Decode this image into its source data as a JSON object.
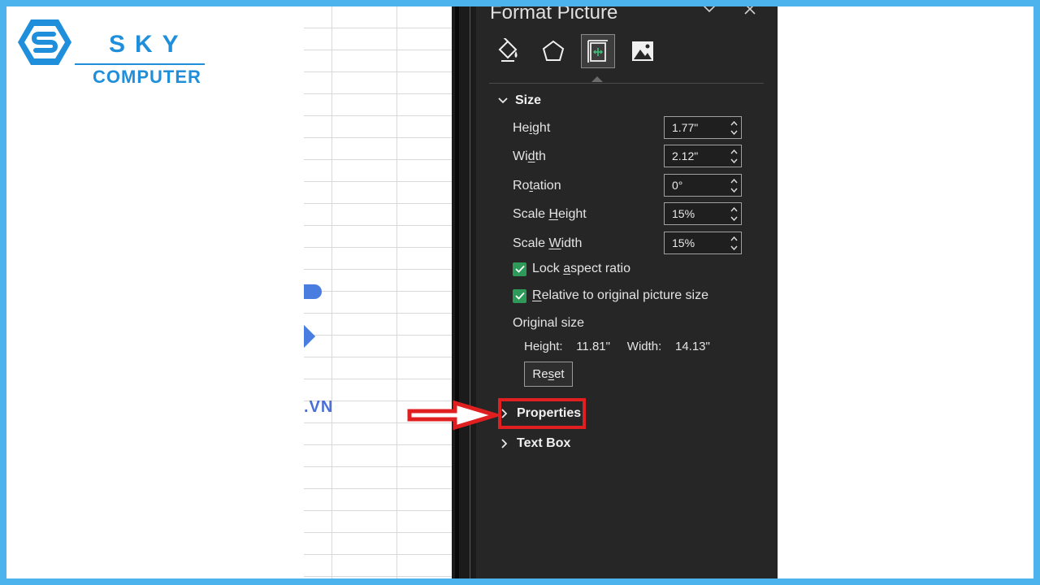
{
  "logo": {
    "brand": "SKY",
    "sub": "COMPUTER"
  },
  "sheet": {
    "fragment_text": ".VN"
  },
  "panel": {
    "title": "Format Picture",
    "tabs": [
      {
        "icon": "fill-line-icon",
        "active": false
      },
      {
        "icon": "effects-pentagon-icon",
        "active": false
      },
      {
        "icon": "size-properties-icon",
        "active": true
      },
      {
        "icon": "picture-icon",
        "active": false
      }
    ],
    "size_section": {
      "label": "Size",
      "fields": [
        {
          "label_pre": "He",
          "label_u": "i",
          "label_post": "ght",
          "value": "1.77\""
        },
        {
          "label_pre": "Wi",
          "label_u": "d",
          "label_post": "th",
          "value": "2.12\""
        },
        {
          "label_pre": "Ro",
          "label_u": "t",
          "label_post": "ation",
          "value": "0°"
        },
        {
          "label_pre": "Scale ",
          "label_u": "H",
          "label_post": "eight",
          "value": "15%"
        },
        {
          "label_pre": "Scale ",
          "label_u": "W",
          "label_post": "idth",
          "value": "15%"
        }
      ],
      "lock_aspect": {
        "pre": "Lock ",
        "u": "a",
        "post": "spect ratio",
        "checked": true
      },
      "relative": {
        "pre": "",
        "u": "R",
        "post": "elative to original picture size",
        "checked": true
      },
      "original_size_label": "Original size",
      "original_height_label": "Height:",
      "original_height": "11.81\"",
      "original_width_label": "Width:",
      "original_width": "14.13\"",
      "reset_pre": "Re",
      "reset_u": "s",
      "reset_post": "et"
    },
    "properties_label": "Properties",
    "textbox_label": "Text Box"
  },
  "colors": {
    "frame": "#4db3ec",
    "brand": "#1f8fdc",
    "panel_bg": "#262626",
    "checkbox": "#2e9a5a",
    "annotation": "#e02020"
  }
}
